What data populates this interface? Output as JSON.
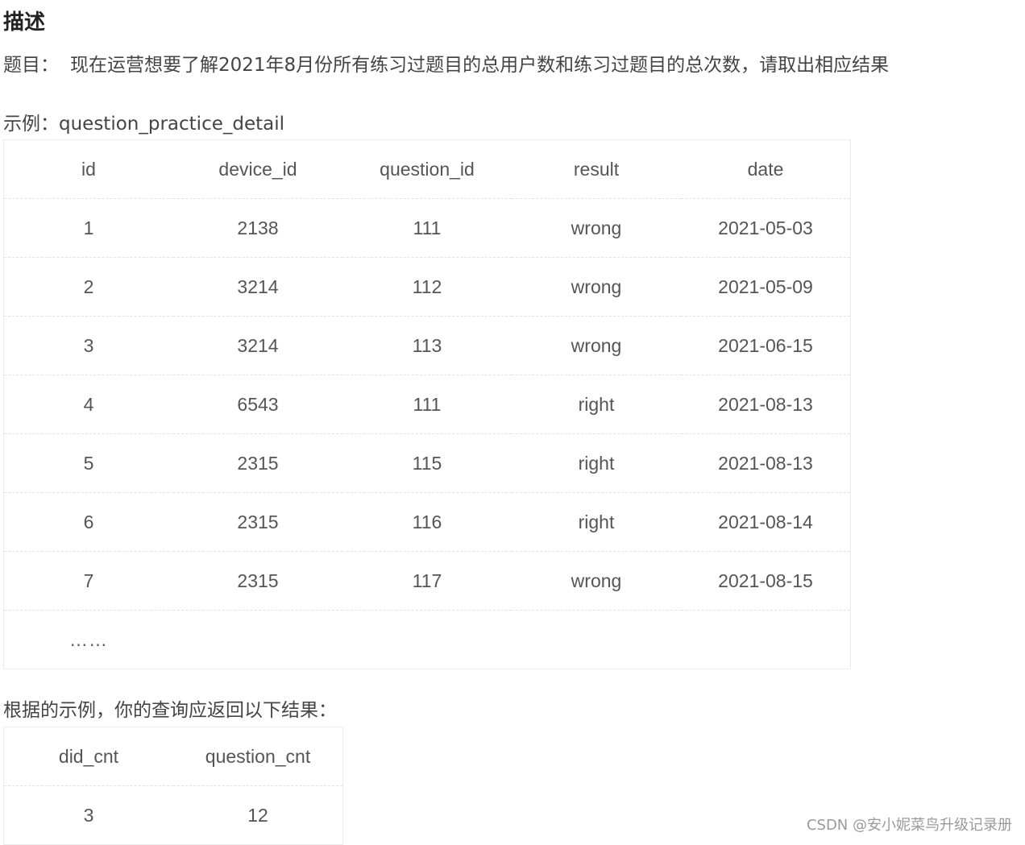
{
  "heading": "描述",
  "question": {
    "label": "题目：",
    "text": "现在运营想要了解2021年8月份所有练习过题目的总用户数和练习过题目的总次数，请取出相应结果"
  },
  "example": {
    "label": "示例：question_practice_detail",
    "columns": [
      "id",
      "device_id",
      "question_id",
      "result",
      "date"
    ],
    "rows": [
      [
        "1",
        "2138",
        "111",
        "wrong",
        "2021-05-03"
      ],
      [
        "2",
        "3214",
        "112",
        "wrong",
        "2021-05-09"
      ],
      [
        "3",
        "3214",
        "113",
        "wrong",
        "2021-06-15"
      ],
      [
        "4",
        "6543",
        "111",
        "right",
        "2021-08-13"
      ],
      [
        "5",
        "2315",
        "115",
        "right",
        "2021-08-13"
      ],
      [
        "6",
        "2315",
        "116",
        "right",
        "2021-08-14"
      ],
      [
        "7",
        "2315",
        "117",
        "wrong",
        "2021-08-15"
      ]
    ],
    "ellipsis": "……"
  },
  "result": {
    "label": "根据的示例，你的查询应返回以下结果：",
    "columns": [
      "did_cnt",
      "question_cnt"
    ],
    "rows": [
      [
        "3",
        "12"
      ]
    ]
  },
  "watermark": "CSDN @安小妮菜鸟升级记录册"
}
